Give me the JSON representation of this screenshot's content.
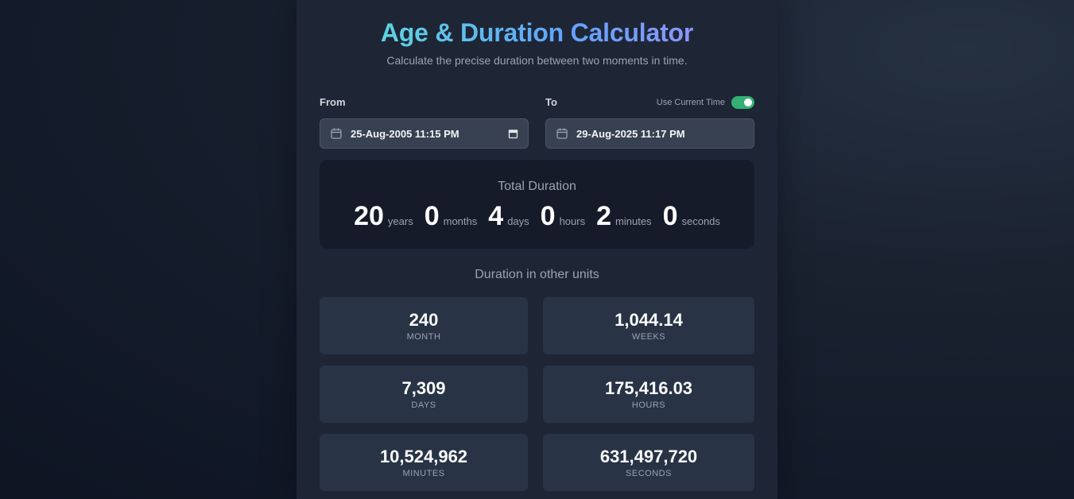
{
  "header": {
    "title": "Age & Duration Calculator",
    "subtitle": "Calculate the precise duration between two moments in time."
  },
  "from": {
    "label": "From",
    "value": "25-Aug-2005  11:15 PM"
  },
  "to": {
    "label": "To",
    "value": "29-Aug-2025  11:17 PM",
    "use_current_time_label": "Use Current Time",
    "use_current_time_on": true
  },
  "total": {
    "title": "Total Duration",
    "segments": [
      {
        "value": "20",
        "unit": "years"
      },
      {
        "value": "0",
        "unit": "months"
      },
      {
        "value": "4",
        "unit": "days"
      },
      {
        "value": "0",
        "unit": "hours"
      },
      {
        "value": "2",
        "unit": "minutes"
      },
      {
        "value": "0",
        "unit": "seconds"
      }
    ]
  },
  "other_units": {
    "title": "Duration in other units",
    "items": [
      {
        "value": "240",
        "label": "MONTH"
      },
      {
        "value": "1,044.14",
        "label": "WEEKS"
      },
      {
        "value": "7,309",
        "label": "DAYS"
      },
      {
        "value": "175,416.03",
        "label": "HOURS"
      },
      {
        "value": "10,524,962",
        "label": "MINUTES"
      },
      {
        "value": "631,497,720",
        "label": "SECONDS"
      }
    ]
  },
  "colors": {
    "toggle_on": "#34b074",
    "title_gradient_start": "#5eead4",
    "title_gradient_end": "#a78bfa"
  }
}
